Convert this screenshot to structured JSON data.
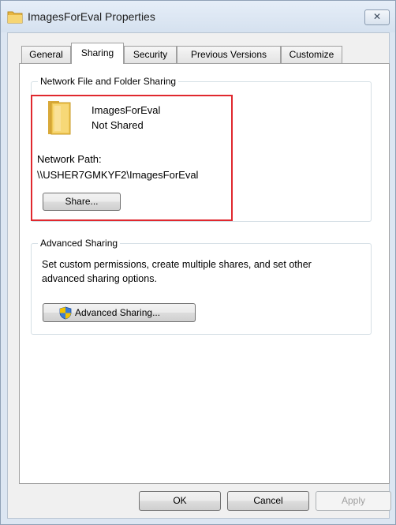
{
  "window": {
    "title": "ImagesForEval Properties",
    "close_glyph": "✕"
  },
  "tabs": [
    {
      "label": "General",
      "active": false
    },
    {
      "label": "Sharing",
      "active": true
    },
    {
      "label": "Security",
      "active": false
    },
    {
      "label": "Previous Versions",
      "active": false
    },
    {
      "label": "Customize",
      "active": false
    }
  ],
  "network_sharing": {
    "group_label": "Network File and Folder Sharing",
    "folder_name": "ImagesForEval",
    "share_status": "Not Shared",
    "network_path_label": "Network Path:",
    "network_path": "\\\\USHER7GMKYF2\\ImagesForEval",
    "share_button": "Share..."
  },
  "advanced_sharing": {
    "group_label": "Advanced Sharing",
    "description_line1": "Set custom permissions, create multiple shares, and set other",
    "description_line2": "advanced sharing options.",
    "button_label": "Advanced Sharing..."
  },
  "footer": {
    "ok": "OK",
    "cancel": "Cancel",
    "apply": "Apply"
  },
  "colors": {
    "highlight": "#e0282e",
    "folder": "#f2c94c"
  }
}
